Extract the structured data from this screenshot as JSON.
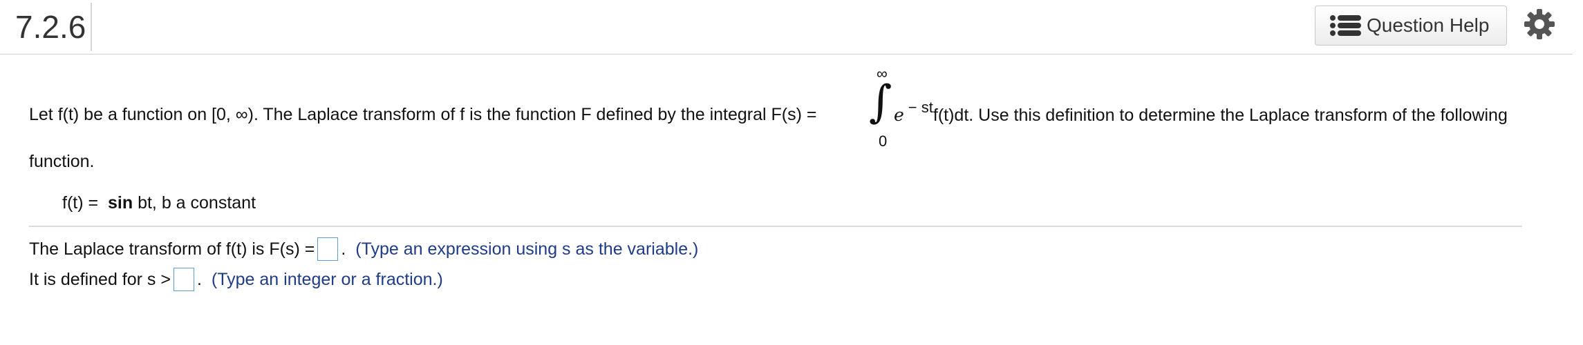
{
  "header": {
    "question_number": "7.2.6",
    "help_button_label": "Question Help",
    "help_icon": "list-icon",
    "settings_icon": "gear-icon"
  },
  "problem": {
    "intro": "Let f(t) be a function on [0, ∞). The Laplace transform of f is the function F defined by the integral F(s) =",
    "integral_upper": "∞",
    "integral_sign": "∫",
    "integral_lower": "0",
    "integrand_e": "e",
    "integrand_exponent": "− st",
    "after_integral": "f(t)dt. Use this definition to determine the Laplace transform of the following",
    "continuation": "function.",
    "function_prefix": "f(t) =",
    "function_bold": "sin",
    "function_suffix": "bt, b a constant"
  },
  "answers": {
    "line1_prefix": "The Laplace transform of f(t) is F(s) =",
    "line1_hint": "(Type an expression using s as the variable.)",
    "line2_prefix": "It is defined for s >",
    "line2_hint": "(Type an integer or a fraction.)",
    "period": ".",
    "input_border_color": "#5b9bd5",
    "hint_color": "#1f3b8a"
  }
}
